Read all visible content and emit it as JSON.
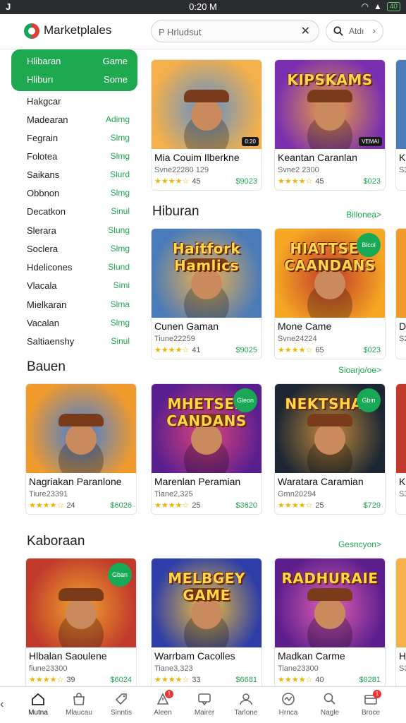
{
  "status_bar": {
    "left": "J",
    "time": "0:20 M",
    "battery": "40"
  },
  "header": {
    "title": "Marketplales",
    "search_placeholder": "P Hrludsut",
    "search2_label": "Atdı"
  },
  "sidebar": {
    "featured": [
      {
        "label": "Hlibaran",
        "value": "Game"
      },
      {
        "label": "Hliburı",
        "value": "Some"
      }
    ],
    "items": [
      {
        "label": "Hakgcar",
        "value": ""
      },
      {
        "label": "Madearan",
        "value": "Adimg"
      },
      {
        "label": "Fegrain",
        "value": "Slmg"
      },
      {
        "label": "Folotea",
        "value": "Slmg"
      },
      {
        "label": "Saikans",
        "value": "Slurd"
      },
      {
        "label": "Obbnon",
        "value": "Slmg"
      },
      {
        "label": "Decatkon",
        "value": "Sinul"
      },
      {
        "label": "Slerara",
        "value": "Slung"
      },
      {
        "label": "Soclera",
        "value": "Slmg"
      },
      {
        "label": "Hdelicones",
        "value": "Slund"
      },
      {
        "label": "Vlacala",
        "value": "Simi"
      },
      {
        "label": "Mielkaran",
        "value": "Slma"
      },
      {
        "label": "Vacalan",
        "value": "Slmg"
      },
      {
        "label": "Saltiaenshy",
        "value": "Sinul"
      }
    ]
  },
  "sections": [
    {
      "title": "",
      "more": "",
      "cards": [
        {
          "name": "Mia Couim Ilberkne",
          "sub": "Svne22280 129",
          "stars": "★★★★☆",
          "count": "45",
          "price": "$9023",
          "art": "",
          "badge": "",
          "pill": "0:20"
        },
        {
          "name": "Keantan Caranlan",
          "sub": "Svne2 2300",
          "stars": "★★★★☆",
          "count": "45",
          "price": "$023",
          "art": "KIPSKAMS",
          "badge": "",
          "pill": "VEMAI"
        }
      ],
      "peek": {
        "name": "Kr",
        "sub": "S3"
      }
    },
    {
      "title": "Hiburan",
      "more": "Billonea>",
      "cards": [
        {
          "name": "Cunen Gaman",
          "sub": "Tiune22259",
          "stars": "★★★★☆",
          "count": "41",
          "price": "$9025",
          "art": "Haitfork Hamlics",
          "badge": "",
          "pill": ""
        },
        {
          "name": "Mone Came",
          "sub": "Svne24224",
          "stars": "★★★★☆",
          "count": "65",
          "price": "$023",
          "art": "HIATTSER CAANDANS",
          "badge": "Blcol",
          "pill": ""
        }
      ],
      "peek": {
        "name": "Di",
        "sub": "S2"
      }
    },
    {
      "title": "Bauen",
      "more": "Sioarjo/oe>",
      "cards": [
        {
          "name": "Nagriakan Paranlone",
          "sub": "Tiure23391",
          "stars": "★★★★☆",
          "count": "24",
          "price": "$6026",
          "art": "",
          "badge": "",
          "pill": ""
        },
        {
          "name": "Marenlan Peramian",
          "sub": "Tiane2,325",
          "stars": "★★★★☆",
          "count": "25",
          "price": "$3620",
          "art": "MHETSEK CANDANS",
          "badge": "Gleon",
          "pill": ""
        },
        {
          "name": "Waratara Caramian",
          "sub": "Gmn20294",
          "stars": "★★★★☆",
          "count": "25",
          "price": "$729",
          "art": "NEKTSHAO",
          "badge": "Gbin",
          "pill": ""
        }
      ],
      "peek": {
        "name": "Ka",
        "sub": "S3"
      }
    },
    {
      "title": "Kaboraan",
      "more": "Gesncyon>",
      "cards": [
        {
          "name": "Hlbalan Saoulene",
          "sub": "fiune23300",
          "stars": "★★★★☆",
          "count": "39",
          "price": "$6024",
          "art": "",
          "badge": "Gban",
          "pill": ""
        },
        {
          "name": "Warrbam Cacolles",
          "sub": "Tiane3,323",
          "stars": "★★★★☆",
          "count": "33",
          "price": "$6681",
          "art": "MELBGEY GAME",
          "badge": "",
          "pill": ""
        },
        {
          "name": "Madkan Carme",
          "sub": "Tiane23300",
          "stars": "★★★★☆",
          "count": "40",
          "price": "$0281",
          "art": "RADHURAIE",
          "badge": "",
          "pill": ""
        }
      ],
      "peek": {
        "name": "Hi",
        "sub": "S3"
      }
    }
  ],
  "bottom_nav": [
    {
      "label": "Mutna",
      "icon": "home-icon"
    },
    {
      "label": "Mlaucau",
      "icon": "bag-icon"
    },
    {
      "label": "Sinntis",
      "icon": "tag-icon"
    },
    {
      "label": "Aleen",
      "icon": "alert-icon",
      "badge": "1"
    },
    {
      "label": "Mairer",
      "icon": "chat-icon"
    },
    {
      "label": "Tarlone",
      "icon": "person-icon"
    },
    {
      "label": "Hrnca",
      "icon": "wave-icon"
    },
    {
      "label": "Nagle",
      "icon": "search-icon"
    },
    {
      "label": "Broce",
      "icon": "box-icon",
      "badge": "1"
    }
  ],
  "colors": {
    "accent": "#1ea84f",
    "star": "#f0b400"
  }
}
